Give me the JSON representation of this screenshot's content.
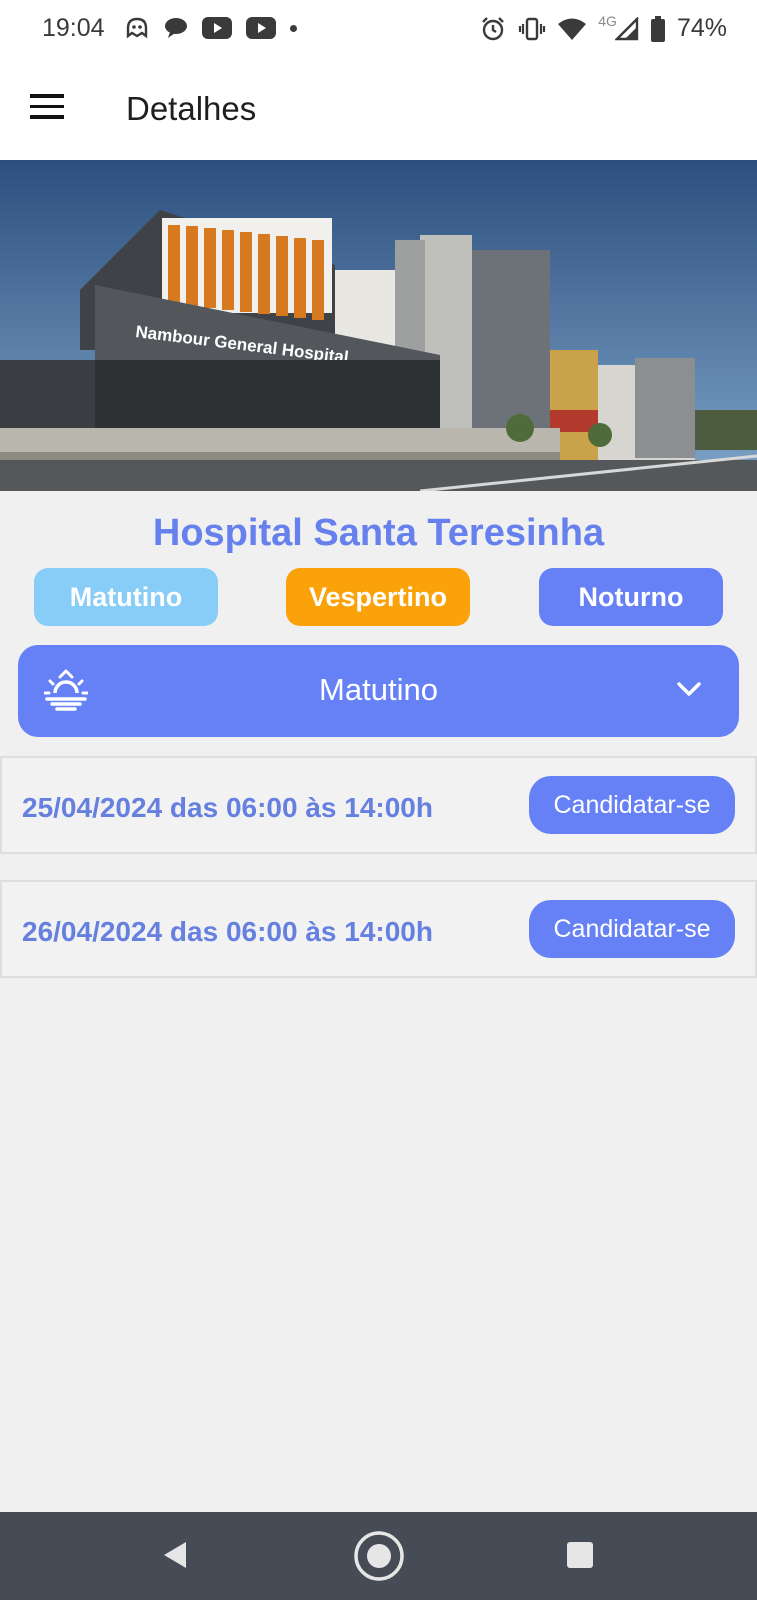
{
  "status_bar": {
    "time": "19:04",
    "battery": "74%",
    "network": "4G"
  },
  "app_bar": {
    "title": "Detalhes",
    "menu_icon": "hamburger-menu-icon"
  },
  "hero": {
    "building_sign": "Nambour General Hospital"
  },
  "hospital": {
    "name": "Hospital Santa Teresinha"
  },
  "shifts": [
    {
      "label": "Matutino",
      "color": "#87cdf8"
    },
    {
      "label": "Vespertino",
      "color": "#fba20b"
    },
    {
      "label": "Noturno",
      "color": "#6680f5"
    }
  ],
  "selected_shift": {
    "label": "Matutino",
    "icon": "sunrise-icon"
  },
  "slots": [
    {
      "text": "25/04/2024 das 06:00 às 14:00h",
      "action": "Candidatar-se"
    },
    {
      "text": "26/04/2024 das 06:00 às 14:00h",
      "action": "Candidatar-se"
    }
  ],
  "colors": {
    "accent": "#6680f5",
    "title_text": "#6680ee",
    "background": "#f0f0f0",
    "navbar": "#454c55"
  }
}
